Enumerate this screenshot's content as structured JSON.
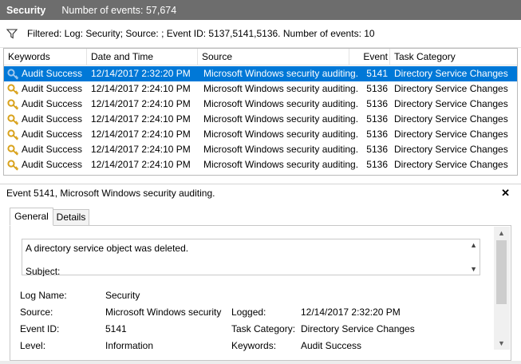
{
  "title": {
    "log_name": "Security",
    "event_count": "Number of events: 57,674"
  },
  "filter": {
    "text": "Filtered: Log: Security; Source: ; Event ID: 5137,5141,5136. Number of events: 10"
  },
  "grid": {
    "columns": [
      "Keywords",
      "Date and Time",
      "Source",
      "Event ID",
      "Task Category"
    ],
    "rows": [
      {
        "keywords": "Audit Success",
        "date": "12/14/2017 2:32:20 PM",
        "source": "Microsoft Windows security auditing.",
        "event_id": "5141",
        "category": "Directory Service Changes"
      },
      {
        "keywords": "Audit Success",
        "date": "12/14/2017 2:24:10 PM",
        "source": "Microsoft Windows security auditing.",
        "event_id": "5136",
        "category": "Directory Service Changes"
      },
      {
        "keywords": "Audit Success",
        "date": "12/14/2017 2:24:10 PM",
        "source": "Microsoft Windows security auditing.",
        "event_id": "5136",
        "category": "Directory Service Changes"
      },
      {
        "keywords": "Audit Success",
        "date": "12/14/2017 2:24:10 PM",
        "source": "Microsoft Windows security auditing.",
        "event_id": "5136",
        "category": "Directory Service Changes"
      },
      {
        "keywords": "Audit Success",
        "date": "12/14/2017 2:24:10 PM",
        "source": "Microsoft Windows security auditing.",
        "event_id": "5136",
        "category": "Directory Service Changes"
      },
      {
        "keywords": "Audit Success",
        "date": "12/14/2017 2:24:10 PM",
        "source": "Microsoft Windows security auditing.",
        "event_id": "5136",
        "category": "Directory Service Changes"
      },
      {
        "keywords": "Audit Success",
        "date": "12/14/2017 2:24:10 PM",
        "source": "Microsoft Windows security auditing.",
        "event_id": "5136",
        "category": "Directory Service Changes"
      }
    ],
    "selected_index": 0
  },
  "detail": {
    "header": "Event 5141, Microsoft Windows security auditing.",
    "close_glyph": "✕",
    "tabs": [
      "General",
      "Details"
    ],
    "message_line1": "A directory service object was deleted.",
    "message_line2": "Subject:",
    "props": {
      "log_name_label": "Log Name:",
      "log_name_value": "Security",
      "source_label": "Source:",
      "source_value": "Microsoft Windows security",
      "logged_label": "Logged:",
      "logged_value": "12/14/2017 2:32:20 PM",
      "event_id_label": "Event ID:",
      "event_id_value": "5141",
      "task_category_label": "Task Category:",
      "task_category_value": "Directory Service Changes",
      "level_label": "Level:",
      "level_value": "Information",
      "keywords_label": "Keywords:",
      "keywords_value": "Audit Success"
    }
  },
  "colors": {
    "selection": "#0078d7",
    "titlebar": "#6d6d6d",
    "key_icon": "#d9a21b"
  },
  "icons": {
    "filter": "filter-funnel-icon",
    "key": "key-icon",
    "close": "close-icon"
  }
}
